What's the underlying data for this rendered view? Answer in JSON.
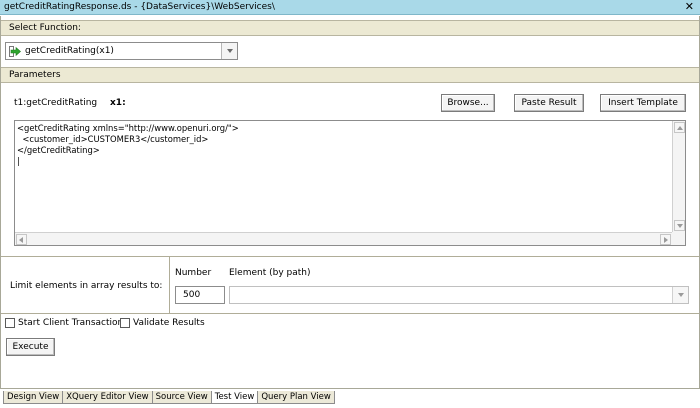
{
  "window": {
    "title": "getCreditRatingResponse.ds - {DataServices}\\WebServices\\"
  },
  "select_function": {
    "header": "Select Function:",
    "selected": "getCreditRating(x1)"
  },
  "parameters": {
    "header": "Parameters",
    "param_label": "t1:getCreditRating",
    "param_name": "x1:",
    "buttons": {
      "browse": "Browse...",
      "paste": "Paste Result",
      "template": "Insert Template"
    },
    "editor_lines": [
      "<getCreditRating xmlns=\"http://www.openuri.org/\">",
      "  <customer_id>CUSTOMER3</customer_id>",
      "</getCreditRating>"
    ]
  },
  "limit": {
    "label": "Limit elements in array results to:",
    "number_header": "Number",
    "element_header": "Element (by path)",
    "number_value": "500",
    "element_value": ""
  },
  "options": {
    "start_client_transaction": "Start Client Transaction",
    "validate_results": "Validate Results"
  },
  "execute_label": "Execute",
  "tabs": [
    "Design View",
    "XQuery Editor View",
    "Source View",
    "Test View",
    "Query Plan View"
  ],
  "active_tab": "Test View",
  "icons": {
    "function": "green-arrow-icon",
    "close": "close-icon",
    "dropdown": "chevron-down-icon"
  },
  "colors": {
    "title_bar": "#a9d9e8",
    "section_header": "#ece9d3",
    "function_icon": "#2ea52e"
  }
}
